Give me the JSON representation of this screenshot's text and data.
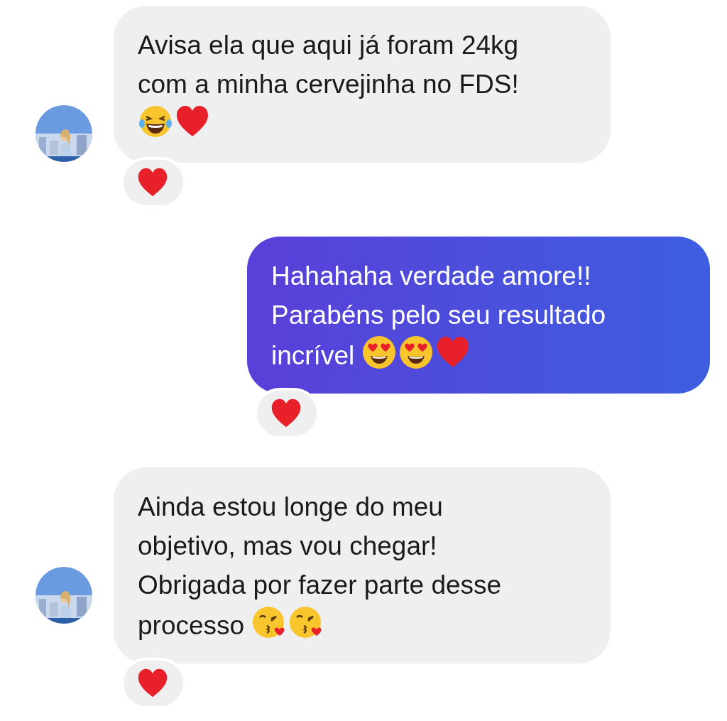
{
  "messages": [
    {
      "kind": "incoming",
      "text": "Avisa ela que aqui já foram 24kg\ncom a minha cervejinha no FDS!\n",
      "emojis": [
        {
          "kind": "laughing"
        },
        {
          "kind": "heart"
        }
      ],
      "reaction": {
        "kind": "heart"
      },
      "avatar": {
        "kind": "picture"
      }
    },
    {
      "kind": "outgoing",
      "text": "Hahahaha verdade amore!!\nParabéns pelo seu resultado\nincrível ",
      "emojis": [
        {
          "kind": "heart-eyes"
        },
        {
          "kind": "heart-eyes"
        },
        {
          "kind": "heart"
        }
      ],
      "reaction": {
        "kind": "heart"
      }
    },
    {
      "kind": "incoming",
      "text": "Ainda estou longe do meu\nobjetivo, mas vou chegar!\nObrigada por fazer parte desse\nprocesso ",
      "emojis": [
        {
          "kind": "kiss"
        },
        {
          "kind": "kiss"
        }
      ],
      "reaction": {
        "kind": "heart"
      },
      "avatar": {
        "kind": "picture"
      }
    }
  ]
}
